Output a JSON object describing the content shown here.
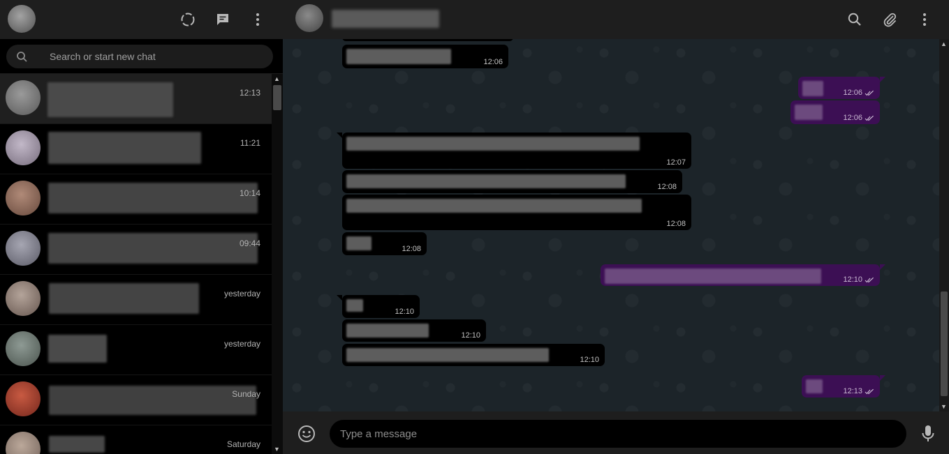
{
  "sidebar": {
    "search": {
      "placeholder": "Search or start new chat"
    },
    "chats": [
      {
        "time": "12:13",
        "avatar_color": "#8a8a8a"
      },
      {
        "time": "11:21",
        "avatar_color": "#a8a0ae"
      },
      {
        "time": "10:14",
        "avatar_color": "#9a7a6a"
      },
      {
        "time": "09:44",
        "avatar_color": "#8c8c96"
      },
      {
        "time": "yesterday",
        "avatar_color": "#9a8a82"
      },
      {
        "time": "yesterday",
        "avatar_color": "#76807a"
      },
      {
        "time": "Sunday",
        "avatar_color": "#b04a35"
      },
      {
        "time": "Saturday",
        "avatar_color": "#a08e82"
      }
    ]
  },
  "conversation": {
    "messages": [
      {
        "time": "12:06",
        "direction": "in"
      },
      {
        "time": "12:06",
        "direction": "out"
      },
      {
        "time": "12:06",
        "direction": "out"
      },
      {
        "time": "12:07",
        "direction": "in"
      },
      {
        "time": "12:08",
        "direction": "in"
      },
      {
        "time": "12:08",
        "direction": "in"
      },
      {
        "time": "12:08",
        "direction": "in"
      },
      {
        "time": "12:10",
        "direction": "out"
      },
      {
        "time": "12:10",
        "direction": "in"
      },
      {
        "time": "12:10",
        "direction": "in"
      },
      {
        "time": "12:10",
        "direction": "in"
      },
      {
        "time": "12:13",
        "direction": "out"
      }
    ]
  },
  "composer": {
    "placeholder": "Type a message"
  },
  "colors": {
    "outgoing_bubble": "#3c0f54",
    "incoming_bubble": "#000000",
    "header": "#1e1e1e"
  },
  "icons": [
    "status-icon",
    "new-chat-icon",
    "menu-icon",
    "search-icon",
    "attach-icon",
    "emoji-icon",
    "mic-icon",
    "double-check-icon"
  ]
}
